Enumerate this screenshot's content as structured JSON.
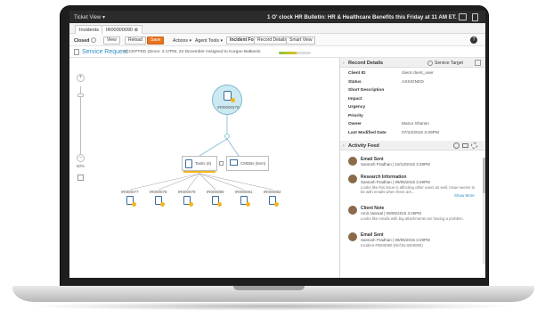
{
  "topbar": {
    "ticket_view": "Ticket View ▾",
    "bulletin": "1 O' clock HR Bulletin: HR & Healthcare Benefits this Friday at 11 AM ET."
  },
  "tabs": [
    {
      "label": "Incidents"
    },
    {
      "label": "IR00000090 ⊗"
    }
  ],
  "toolbar": {
    "status_label": "Closed",
    "view": "View",
    "reload": "Reload",
    "save": "Save",
    "actions": "Actions ▾",
    "agent_tools": "Agent Tools ▾",
    "incident_form": "Incident Form",
    "record_details": "Record Details",
    "smart_view": "Smart View"
  },
  "header": {
    "title": "Service Request",
    "subtitle": "ACCEPTED (Since: 4:17PM, 22 December Assigned to Kurgan Balkanlo",
    "progress": 0.55
  },
  "canvas": {
    "zoom_plus": "+",
    "zoom_minus": "−",
    "zoom_pct": "50%",
    "center_node": "IR00000278",
    "tasks_label": "Tasks (6)",
    "cmdb_label": "CMDBs (item)",
    "children": [
      "IR000077",
      "IR000078",
      "IR000079",
      "IR000080",
      "IR000081",
      "IR000082"
    ]
  },
  "record": {
    "title": "Record Details",
    "service_target": "Service Target",
    "fields": [
      {
        "k": "Client ID",
        "v": "client client_user"
      },
      {
        "k": "Status",
        "v": "ASSIGNED"
      },
      {
        "k": "Short Description",
        "v": ""
      },
      {
        "k": "Impact",
        "v": ""
      },
      {
        "k": "Urgency",
        "v": ""
      },
      {
        "k": "Priority",
        "v": ""
      },
      {
        "k": "Owner",
        "v": "Mazur Shamin"
      },
      {
        "k": "Last Modified Date",
        "v": "07/22/2016 3:29PM"
      }
    ]
  },
  "feed": {
    "title": "Activity Feed",
    "show_more": "Show More",
    "items": [
      {
        "title": "Email Sent",
        "meta": "Santosh Pradhan | 10/13/2015 3:29PM",
        "text": ""
      },
      {
        "title": "Research Information",
        "meta": "Santosh Pradhan | 09/05/2015 3:29PM",
        "text": "Looks like this issue is affecting other users as well, Issue seems to be with emails when there are..."
      },
      {
        "title": "Client Note",
        "meta": "Amit Jaiswal | 09/05/2015 3:29PM",
        "text": "Looks like emails with big attachments are having a problem."
      },
      {
        "title": "Email Sent",
        "meta": "Santosh Pradhan | 09/05/2015 3:29PM",
        "text": "Incident #0000080 (Ref:IN-0000080)"
      }
    ]
  },
  "colors": {
    "accent": "#e8741e",
    "link": "#2f8fc3",
    "node": "#cde9f3"
  }
}
